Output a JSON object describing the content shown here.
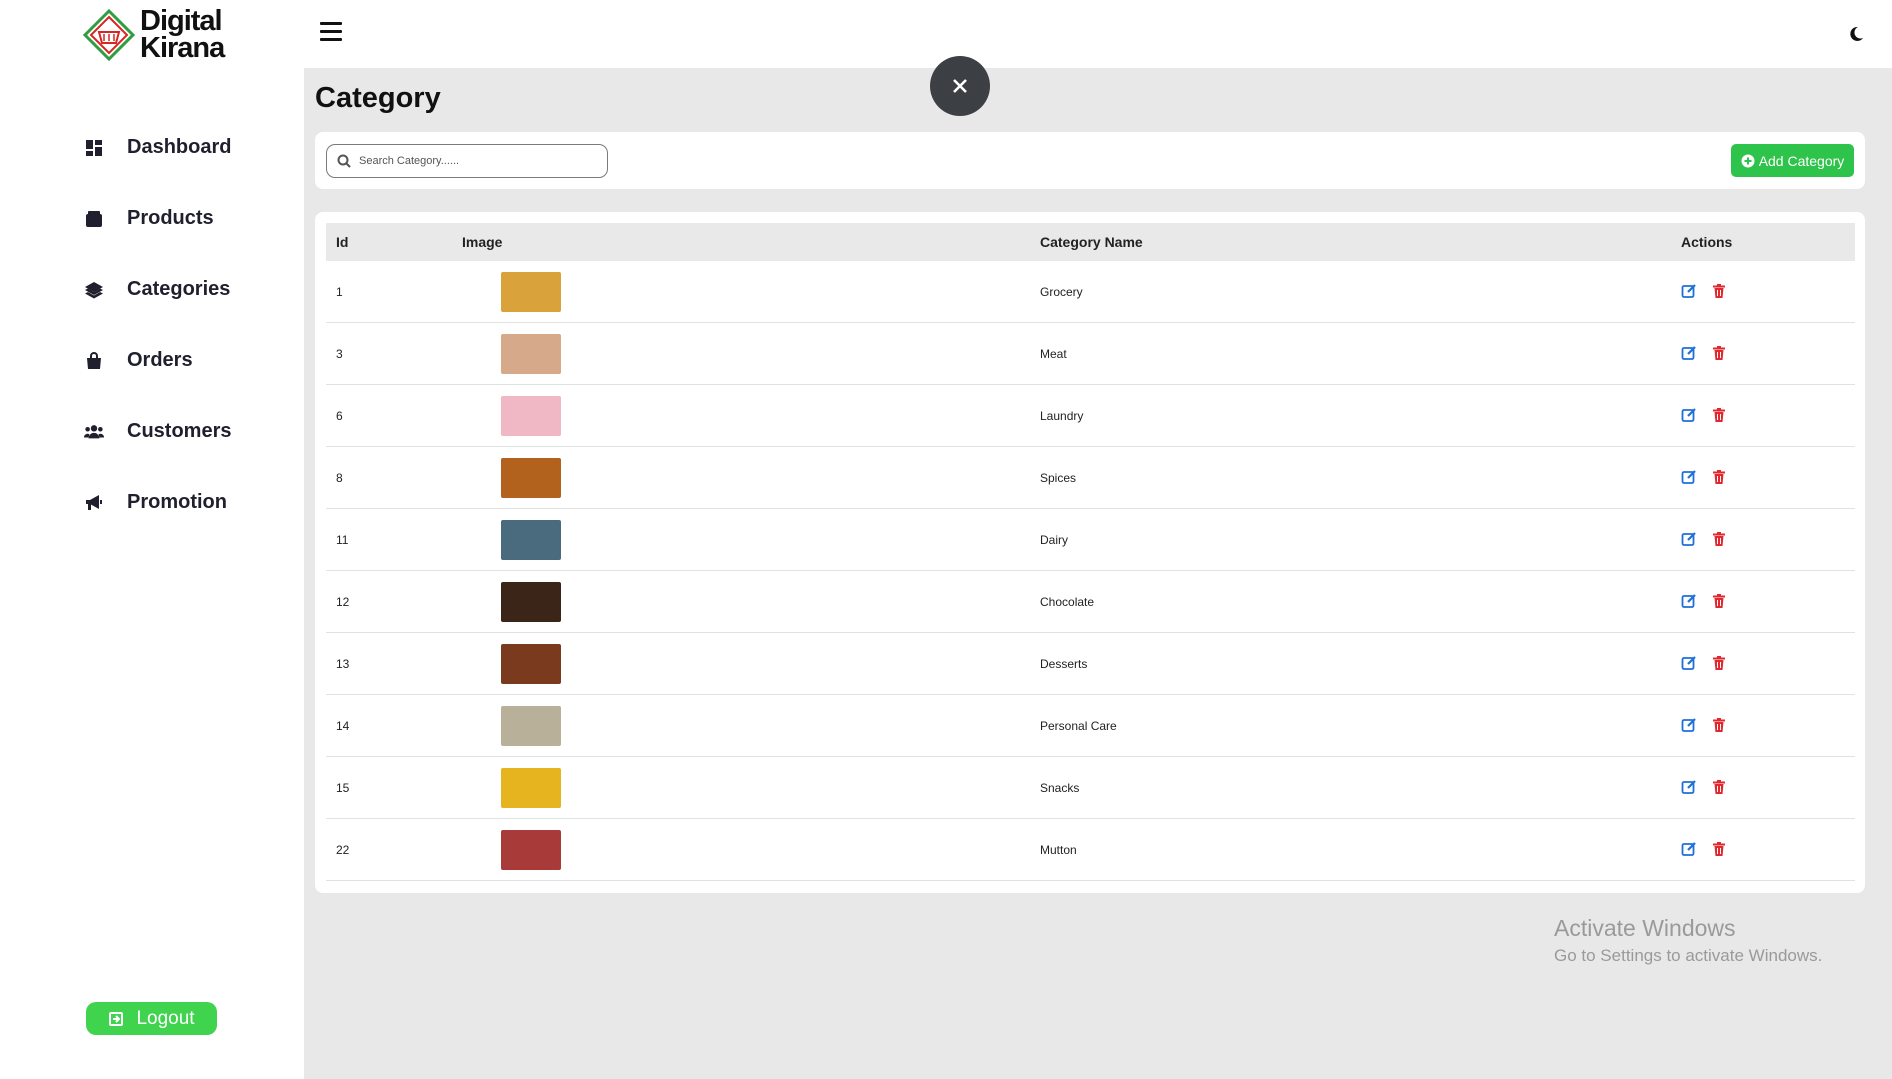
{
  "brand": {
    "line1": "Digital",
    "line2": "Kirana"
  },
  "sidebar": {
    "items": [
      {
        "label": "Dashboard",
        "icon": "dashboard-icon"
      },
      {
        "label": "Products",
        "icon": "box-icon"
      },
      {
        "label": "Categories",
        "icon": "layers-icon"
      },
      {
        "label": "Orders",
        "icon": "shopping-bag-icon"
      },
      {
        "label": "Customers",
        "icon": "users-icon"
      },
      {
        "label": "Promotion",
        "icon": "megaphone-icon"
      }
    ],
    "logout_label": "Logout"
  },
  "page": {
    "title": "Category"
  },
  "search": {
    "placeholder": "Search Category......"
  },
  "actions": {
    "add_label": "Add Category"
  },
  "table": {
    "headers": {
      "id": "Id",
      "image": "Image",
      "name": "Category Name",
      "actions": "Actions"
    },
    "rows": [
      {
        "id": "1",
        "name": "Grocery",
        "thumb_color": "#d9a23a"
      },
      {
        "id": "3",
        "name": "Meat",
        "thumb_color": "#d6a98a"
      },
      {
        "id": "6",
        "name": "Laundry",
        "thumb_color": "#f0b8c4"
      },
      {
        "id": "8",
        "name": "Spices",
        "thumb_color": "#b3621d"
      },
      {
        "id": "11",
        "name": "Dairy",
        "thumb_color": "#4a6a7e"
      },
      {
        "id": "12",
        "name": "Chocolate",
        "thumb_color": "#3b2418"
      },
      {
        "id": "13",
        "name": "Desserts",
        "thumb_color": "#7a3a1e"
      },
      {
        "id": "14",
        "name": "Personal Care",
        "thumb_color": "#b9b09a"
      },
      {
        "id": "15",
        "name": "Snacks",
        "thumb_color": "#e6b41f"
      },
      {
        "id": "22",
        "name": "Mutton",
        "thumb_color": "#a83a3a"
      }
    ]
  },
  "watermark": {
    "line1": "Activate Windows",
    "line2": "Go to Settings to activate Windows."
  },
  "colors": {
    "accent_green": "#2ec34a",
    "edit_blue": "#1f6fd8",
    "delete_red": "#e0282e",
    "close_dark": "#3c3f44"
  }
}
